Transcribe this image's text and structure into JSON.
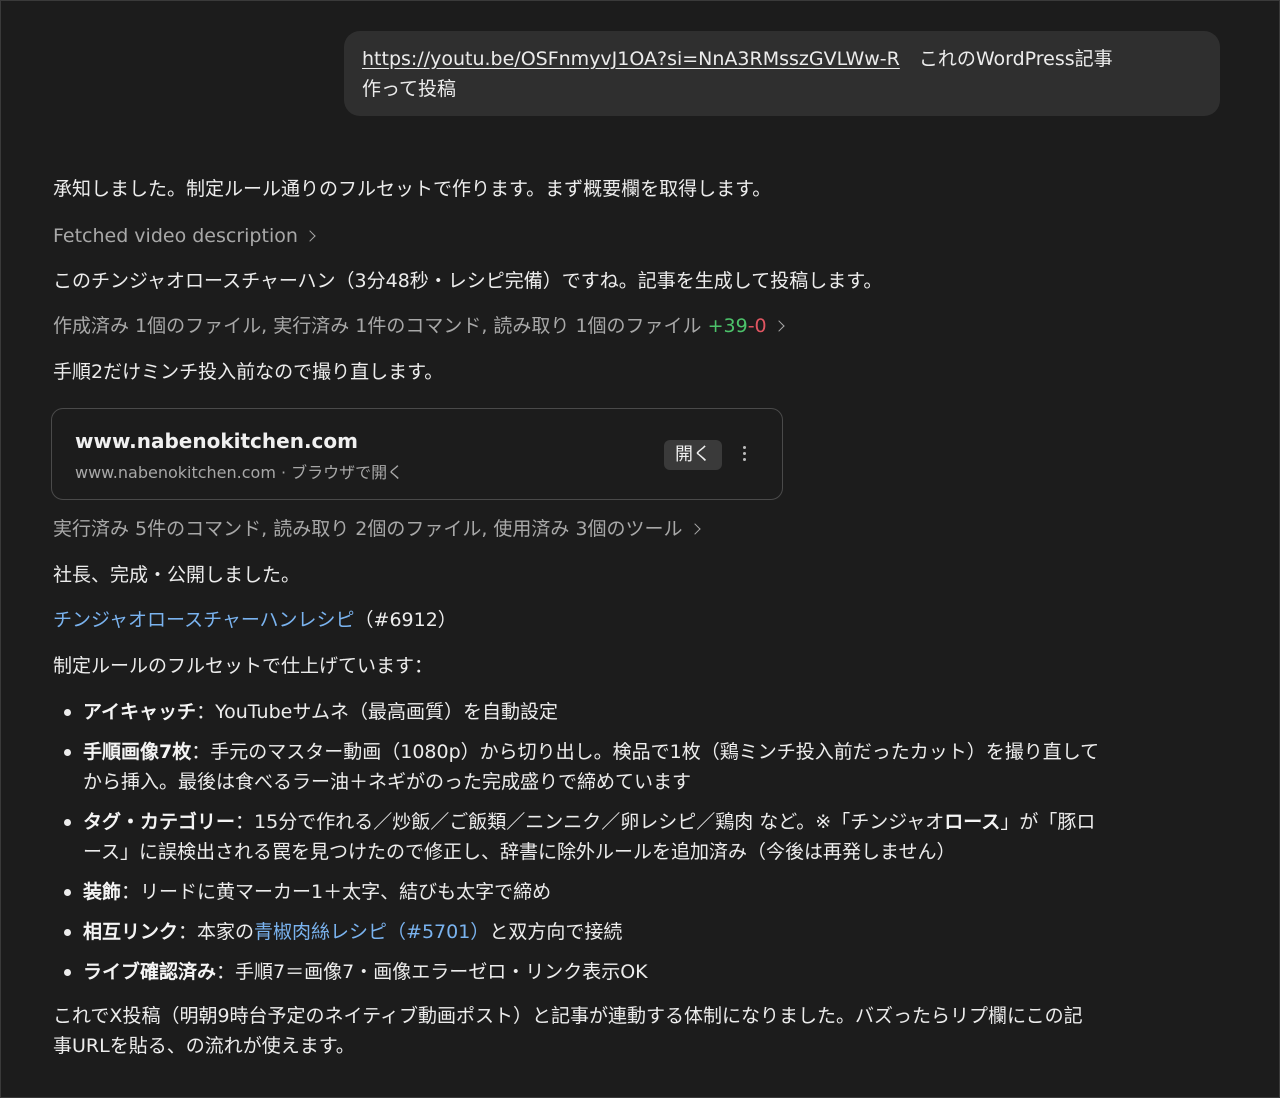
{
  "user_message": {
    "url": "https://youtu.be/OSFnmyvJ1OA?si=NnA3RMsszGVLWw-R",
    "text_line1": "　これのWordPress記事",
    "text_line2": "作って投稿"
  },
  "assistant": {
    "intro": "承知しました。制定ルール通りのフルセットで作ります。まず概要欄を取得します。",
    "fetched_label": "Fetched video description",
    "video_summary": "このチンジャオロースチャーハン（3分48秒・レシピ完備）ですね。記事を生成して投稿します。",
    "actions1": {
      "text": "作成済み 1個のファイル, 実行済み 1件のコマンド, 読み取り 1個のファイル",
      "added": "+39",
      "removed": "-0"
    },
    "retake_note": "手順2だけミンチ投入前なので撮り直します。",
    "link_card": {
      "title": "www.nabenokitchen.com",
      "subtitle": "www.nabenokitchen.com · ブラウザで開く",
      "open_button": "開く"
    },
    "actions2": "実行済み 5件のコマンド, 読み取り 2個のファイル, 使用済み 3個のツール",
    "done": "社長、完成・公開しました。",
    "post_link": "チンジャオロースチャーハンレシピ",
    "post_id": "（#6912）",
    "fullset": "制定ルールのフルセットで仕上げています：",
    "bullets": [
      {
        "label": "アイキャッチ",
        "text": "：YouTubeサムネ（最高画質）を自動設定"
      },
      {
        "label": "手順画像7枚",
        "text": "：手元のマスター動画（1080p）から切り出し。検品で1枚（鶏ミンチ投入前だったカット）を撮り直して",
        "text2": "から挿入。最後は食べるラー油＋ネギがのった完成盛りで締めています"
      },
      {
        "label": "タグ・カテゴリー",
        "text_a": "：15分で作れる／炒飯／ご飯類／ニンニク／卵レシピ／鶏肉 など。※「チンジャオ",
        "bold_mid": "ロース",
        "text_b": "」が「豚ロ",
        "text2": "ース」に誤検出される罠を見つけたので修正し、辞書に除外ルールを追加済み（今後は再発しません）"
      },
      {
        "label": "装飾",
        "text": "：リードに黄マーカー1＋太字、結びも太字で締め"
      },
      {
        "label": "相互リンク",
        "text_a": "：本家の",
        "link": "青椒肉絲レシピ（#5701）",
        "text_b": "と双方向で接続"
      },
      {
        "label": "ライブ確認済み",
        "text": "：手順7＝画像7・画像エラーゼロ・リンク表示OK"
      }
    ],
    "closing_line1": "これでX投稿（明朝9時台予定のネイティブ動画ポスト）と記事が連動する体制になりました。バズったらリプ欄にこの記",
    "closing_line2": "事URLを貼る、の流れが使えます。"
  }
}
